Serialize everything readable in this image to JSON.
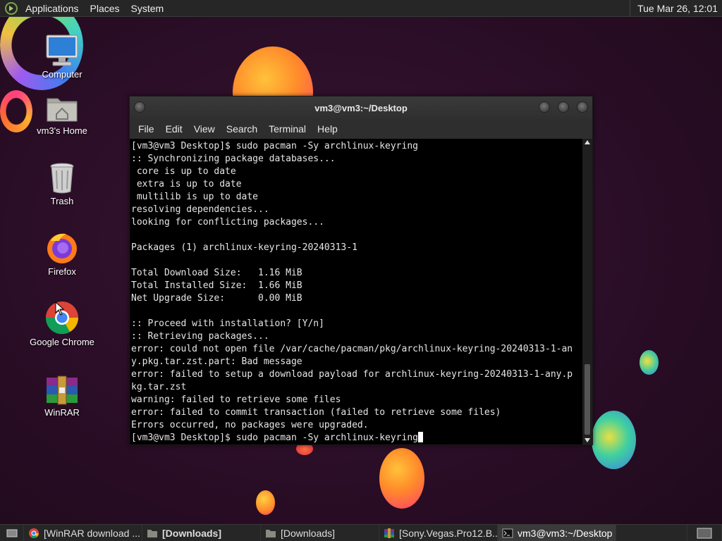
{
  "top_panel": {
    "menus": [
      "Applications",
      "Places",
      "System"
    ],
    "clock": "Tue Mar 26, 12:01"
  },
  "desktop": {
    "icons": [
      {
        "label": "Computer",
        "icon": "computer-icon"
      },
      {
        "label": "vm3's Home",
        "icon": "home-folder-icon"
      },
      {
        "label": "Trash",
        "icon": "trash-icon"
      },
      {
        "label": "Firefox",
        "icon": "firefox-icon"
      },
      {
        "label": "Google Chrome",
        "icon": "chrome-icon"
      },
      {
        "label": "WinRAR",
        "icon": "winrar-icon"
      }
    ]
  },
  "terminal": {
    "title": "vm3@vm3:~/Desktop",
    "menu": [
      "File",
      "Edit",
      "View",
      "Search",
      "Terminal",
      "Help"
    ],
    "lines": [
      "[vm3@vm3 Desktop]$ sudo pacman -Sy archlinux-keyring",
      ":: Synchronizing package databases...",
      " core is up to date",
      " extra is up to date",
      " multilib is up to date",
      "resolving dependencies...",
      "looking for conflicting packages...",
      "",
      "Packages (1) archlinux-keyring-20240313-1",
      "",
      "Total Download Size:   1.16 MiB",
      "Total Installed Size:  1.66 MiB",
      "Net Upgrade Size:      0.00 MiB",
      "",
      ":: Proceed with installation? [Y/n]",
      ":: Retrieving packages...",
      "error: could not open file /var/cache/pacman/pkg/archlinux-keyring-20240313-1-an",
      "y.pkg.tar.zst.part: Bad message",
      "error: failed to setup a download payload for archlinux-keyring-20240313-1-any.p",
      "kg.tar.zst",
      "warning: failed to retrieve some files",
      "error: failed to commit transaction (failed to retrieve some files)",
      "Errors occurred, no packages were upgraded."
    ],
    "prompt_line": "[vm3@vm3 Desktop]$ sudo pacman -Sy archlinux-keyring"
  },
  "taskbar": {
    "tasks": [
      {
        "label": "[WinRAR download ...",
        "icon": "chrome-icon",
        "active": false,
        "bold": false
      },
      {
        "label": "[Downloads]",
        "icon": "folder-icon",
        "active": false,
        "bold": true
      },
      {
        "label": "[Downloads]",
        "icon": "folder-icon",
        "active": false,
        "bold": false
      },
      {
        "label": "[Sony.Vegas.Pro12.B...",
        "icon": "archive-icon",
        "active": false,
        "bold": false
      },
      {
        "label": "vm3@vm3:~/Desktop",
        "icon": "terminal-icon",
        "active": true,
        "bold": false
      }
    ]
  },
  "colors": {
    "panel_bg": "#262626",
    "terminal_bg": "#000000",
    "terminal_fg": "#e6e6e6",
    "wallpaper": "#2a0d26"
  }
}
